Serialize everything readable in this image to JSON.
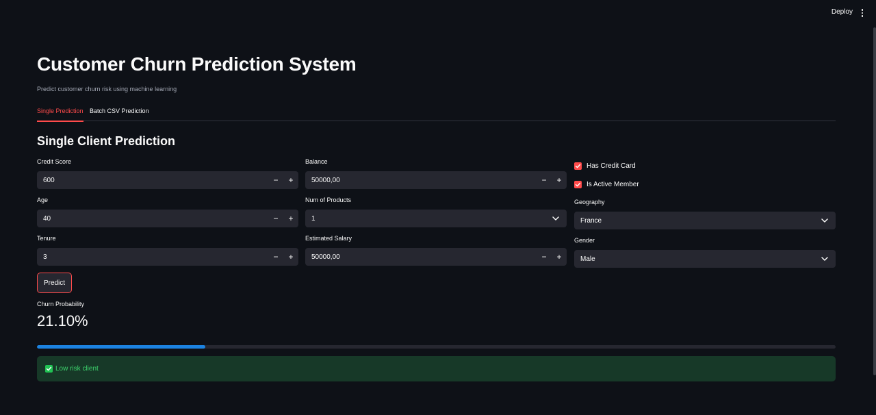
{
  "header": {
    "deploy_label": "Deploy",
    "menu_icon": "vertical-ellipsis-icon"
  },
  "page": {
    "title": "Customer Churn Prediction System",
    "subtitle": "Predict customer churn risk using machine learning"
  },
  "tabs": [
    {
      "label": "Single Prediction",
      "active": true
    },
    {
      "label": "Batch CSV Prediction",
      "active": false
    }
  ],
  "section": {
    "title": "Single Client Prediction"
  },
  "form": {
    "credit_score": {
      "label": "Credit Score",
      "value": "600"
    },
    "age": {
      "label": "Age",
      "value": "40"
    },
    "tenure": {
      "label": "Tenure",
      "value": "3"
    },
    "balance": {
      "label": "Balance",
      "value": "50000,00"
    },
    "num_products": {
      "label": "Num of Products",
      "value": "1"
    },
    "estimated_salary": {
      "label": "Estimated Salary",
      "value": "50000,00"
    },
    "has_credit_card": {
      "label": "Has Credit Card",
      "checked": true
    },
    "is_active_member": {
      "label": "Is Active Member",
      "checked": true
    },
    "geography": {
      "label": "Geography",
      "value": "France"
    },
    "gender": {
      "label": "Gender",
      "value": "Male"
    },
    "minus": "−",
    "plus": "+"
  },
  "predict_label": "Predict",
  "result": {
    "metric_label": "Churn Probability",
    "metric_value": "21.10%",
    "progress": 0.211,
    "alert_text": "Low risk client"
  },
  "colors": {
    "accent": "#ff4b4b",
    "progress": "#1c83e1",
    "success_bg": "#173928",
    "success_text": "#3dd56d",
    "background": "#0e1117",
    "input_bg": "#262730"
  }
}
